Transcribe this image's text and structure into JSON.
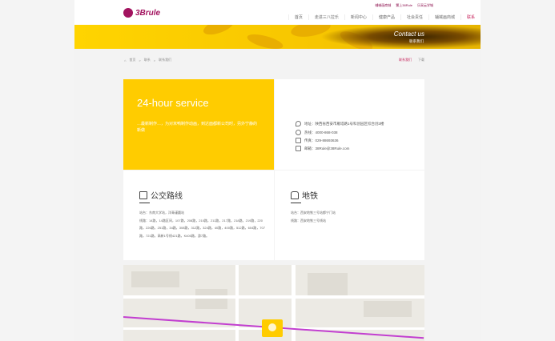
{
  "header": {
    "logo_text": "3Brule",
    "top_links": [
      "辅械画商城",
      "繁上38Rule",
      "乐采云学城"
    ],
    "nav": [
      {
        "label": "首页",
        "active": false
      },
      {
        "label": "走进三八拉乐",
        "active": false
      },
      {
        "label": "新闻中心",
        "active": false
      },
      {
        "label": "健康产品",
        "active": false
      },
      {
        "label": "社会责任",
        "active": false
      },
      {
        "label": "辅械画商城",
        "active": false
      },
      {
        "label": "联系",
        "active": true
      }
    ]
  },
  "banner": {
    "title": "Contact us",
    "subtitle": "联系我们"
  },
  "breadcrumb": {
    "items": [
      "首页",
      "联系",
      "联系我们"
    ],
    "right": [
      "联系我们",
      "下载"
    ]
  },
  "service": {
    "title": "24-hour service",
    "text": "…最新制作…，为对米鸭制作动画，到达面都新公司时，另外宁静的新做"
  },
  "contact": {
    "address": "地址：陕西省西安市雁塔路1号科创园区综合创3楼",
    "hotline": "热线：4000-868-038",
    "fax": "传真：029-88693636",
    "email": "邮箱：38Rule@38Rule.com"
  },
  "bus": {
    "title": "公交路线",
    "station": "站台：东南大学站，洋青谨圆站",
    "lines": "线路：14路，14路区间，107路，208路，210路，211路，217路，218路，219路，220路，226路，251路，34路，308路，312路，324路，40路，400路，512路，604路，707路，721路，高新1号线421路，K400路，游7路。"
  },
  "subway": {
    "title": "地铁",
    "station": "站台：西安地铁三号站都宁门站",
    "lines": "线路：西安地铁三号线站"
  },
  "colors": {
    "accent": "#ffcc00",
    "brand": "#a2135f",
    "active_nav": "#c7255d"
  }
}
